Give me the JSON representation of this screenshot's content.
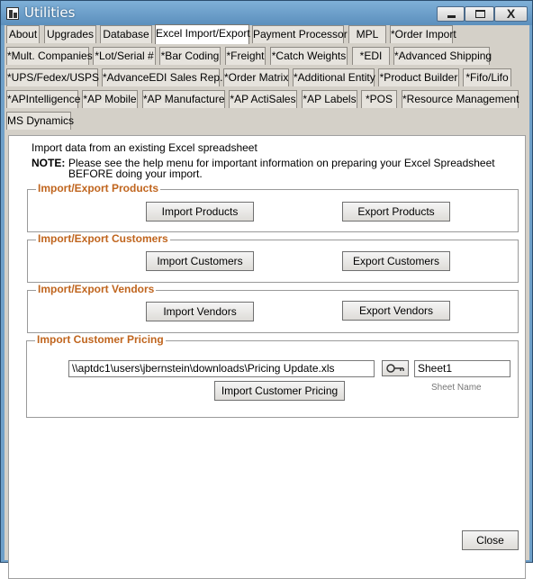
{
  "window": {
    "title": "Utilities",
    "buttons": {
      "close_glyph": "X"
    }
  },
  "tabs": [
    {
      "label": "About"
    },
    {
      "label": "Upgrades"
    },
    {
      "label": "Database"
    },
    {
      "label": "Excel Import/Export",
      "active": true
    },
    {
      "label": "Payment Processor"
    },
    {
      "label": "MPL"
    },
    {
      "label": "*Order Import"
    },
    {
      "label": "*Mult. Companies"
    },
    {
      "label": "*Lot/Serial #"
    },
    {
      "label": "*Bar Coding"
    },
    {
      "label": "*Freight"
    },
    {
      "label": "*Catch Weights"
    },
    {
      "label": "*EDI"
    },
    {
      "label": "*Advanced Shipping"
    },
    {
      "label": "*UPS/Fedex/USPS"
    },
    {
      "label": "*AdvanceEDI Sales Rep."
    },
    {
      "label": "*Order Matrix"
    },
    {
      "label": "*Additional Entity"
    },
    {
      "label": "*Product Builder"
    },
    {
      "label": "*Fifo/Lifo"
    },
    {
      "label": "*APIntelligence"
    },
    {
      "label": "*AP Mobile"
    },
    {
      "label": "*AP Manufacture"
    },
    {
      "label": "*AP ActiSales"
    },
    {
      "label": "*AP Labels"
    },
    {
      "label": "*POS"
    },
    {
      "label": "*Resource Management"
    },
    {
      "label": "MS Dynamics"
    }
  ],
  "content": {
    "intro": "Import data from an existing Excel spreadsheet",
    "note_label": "NOTE:",
    "note_line1": "Please see the help menu for important information on preparing your Excel Spreadsheet",
    "note_line2": "BEFORE doing your import."
  },
  "groups": {
    "products": {
      "title": "Import/Export Products",
      "import_label": "Import Products",
      "export_label": "Export Products"
    },
    "customers": {
      "title": "Import/Export Customers",
      "import_label": "Import Customers",
      "export_label": "Export Customers"
    },
    "vendors": {
      "title": "Import/Export Vendors",
      "import_label": "Import Vendors",
      "export_label": "Export Vendors"
    },
    "pricing": {
      "title": "Import Customer Pricing",
      "file_path": "\\\\aptdc1\\users\\jbernstein\\downloads\\Pricing Update.xls",
      "sheet_value": "Sheet1",
      "sheet_caption": "Sheet Name",
      "import_label": "Import Customer Pricing"
    }
  },
  "footer": {
    "close_label": "Close"
  },
  "colors": {
    "group_title": "#c0651e",
    "titlebar": "#6fa0c9"
  }
}
